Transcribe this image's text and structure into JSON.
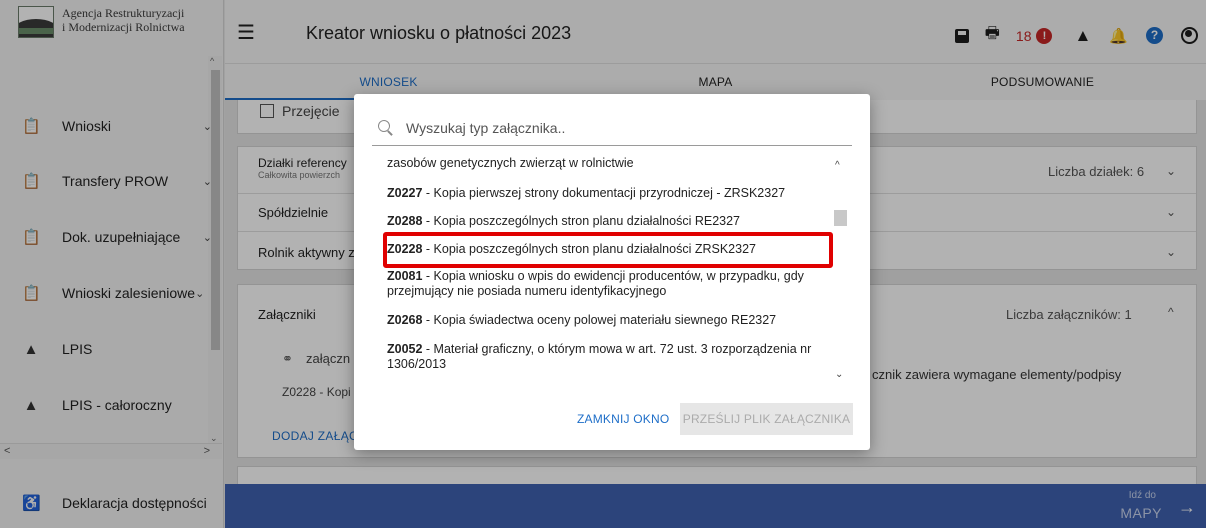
{
  "sidebar": {
    "logo_line1": "Agencja Restrukturyzacji",
    "logo_line2": "i Modernizacji Rolnictwa",
    "logo_mark": "ARiMR",
    "items": [
      {
        "label": "Wnioski",
        "icon": "clipboard-icon",
        "has_chevron": true
      },
      {
        "label": "Transfery PROW",
        "icon": "clipboard-icon",
        "has_chevron": true
      },
      {
        "label": "Dok. uzupełniające",
        "icon": "clipboard-icon",
        "has_chevron": true
      },
      {
        "label": "Wnioski zalesieniowe",
        "icon": "clipboard-icon",
        "has_chevron": true
      },
      {
        "label": "LPIS",
        "icon": "mountain-icon",
        "has_chevron": false
      },
      {
        "label": "LPIS - całoroczny",
        "icon": "mountain-icon",
        "has_chevron": false
      },
      {
        "label": "Deklaracja dostępności",
        "icon": "accessibility-icon",
        "has_chevron": false
      }
    ]
  },
  "header": {
    "title": "Kreator wniosku o płatności 2023",
    "alert_count": "18",
    "alert_mark": "!",
    "help_mark": "?"
  },
  "tabs": [
    {
      "label": "WNIOSEK",
      "active": true
    },
    {
      "label": "MAPA",
      "active": false
    },
    {
      "label": "PODSUMOWANIE",
      "active": false
    }
  ],
  "main": {
    "checkbox_label": "Przejęcie",
    "dzialki_label": "Działki referency",
    "dzialki_sub": "Całkowita powierzch",
    "dzialki_count": "Liczba działek: 6",
    "spoldzielnie": "Spółdzielnie",
    "rolnik": "Rolnik aktywny z",
    "zalaczniki": "Załączniki",
    "zalaczniki_count": "Liczba załączników: 1",
    "attachment_label": "załączn",
    "attachment_row": "Z0228 - Kopi",
    "attachment_note": "cznik zawiera wymagane elementy/podpisy",
    "add_attachment": "DODAJ ZAŁĄCZ"
  },
  "footer": {
    "goto_small": "Idź do",
    "goto_big": "MAPY"
  },
  "modal": {
    "search_placeholder": "Wyszukaj typ załącznika..",
    "items": [
      {
        "code": "",
        "text": "zasobów genetycznych zwierząt w rolnictwie"
      },
      {
        "code": "Z0227",
        "text": " - Kopia pierwszej strony dokumentacji przyrodniczej - ZRSK2327"
      },
      {
        "code": "Z0288",
        "text": " - Kopia poszczególnych stron planu działalności RE2327"
      },
      {
        "code": "Z0228",
        "text": " - Kopia poszczególnych stron planu działalności ZRSK2327"
      },
      {
        "code": "Z0081",
        "text": " - Kopia wniosku o wpis do ewidencji producentów, w przypadku, gdy przejmujący nie posiada numeru identyfikacyjnego"
      },
      {
        "code": "Z0268",
        "text": " - Kopia świadectwa oceny polowej materiału siewnego RE2327"
      },
      {
        "code": "Z0052",
        "text": " - Materiał graficzny, o którym mowa w art. 72 ust. 3 rozporządzenia nr 1306/2013"
      }
    ],
    "highlighted_code": "Z0228",
    "close_button": "ZAMKNIJ OKNO",
    "send_button": "PRZEŚLIJ PLIK ZAŁĄCZNIKA"
  },
  "colors": {
    "accent": "#1e6ec8",
    "alert": "#c62828",
    "footer_bar": "#3f62b0",
    "highlight_border": "#e00000"
  }
}
